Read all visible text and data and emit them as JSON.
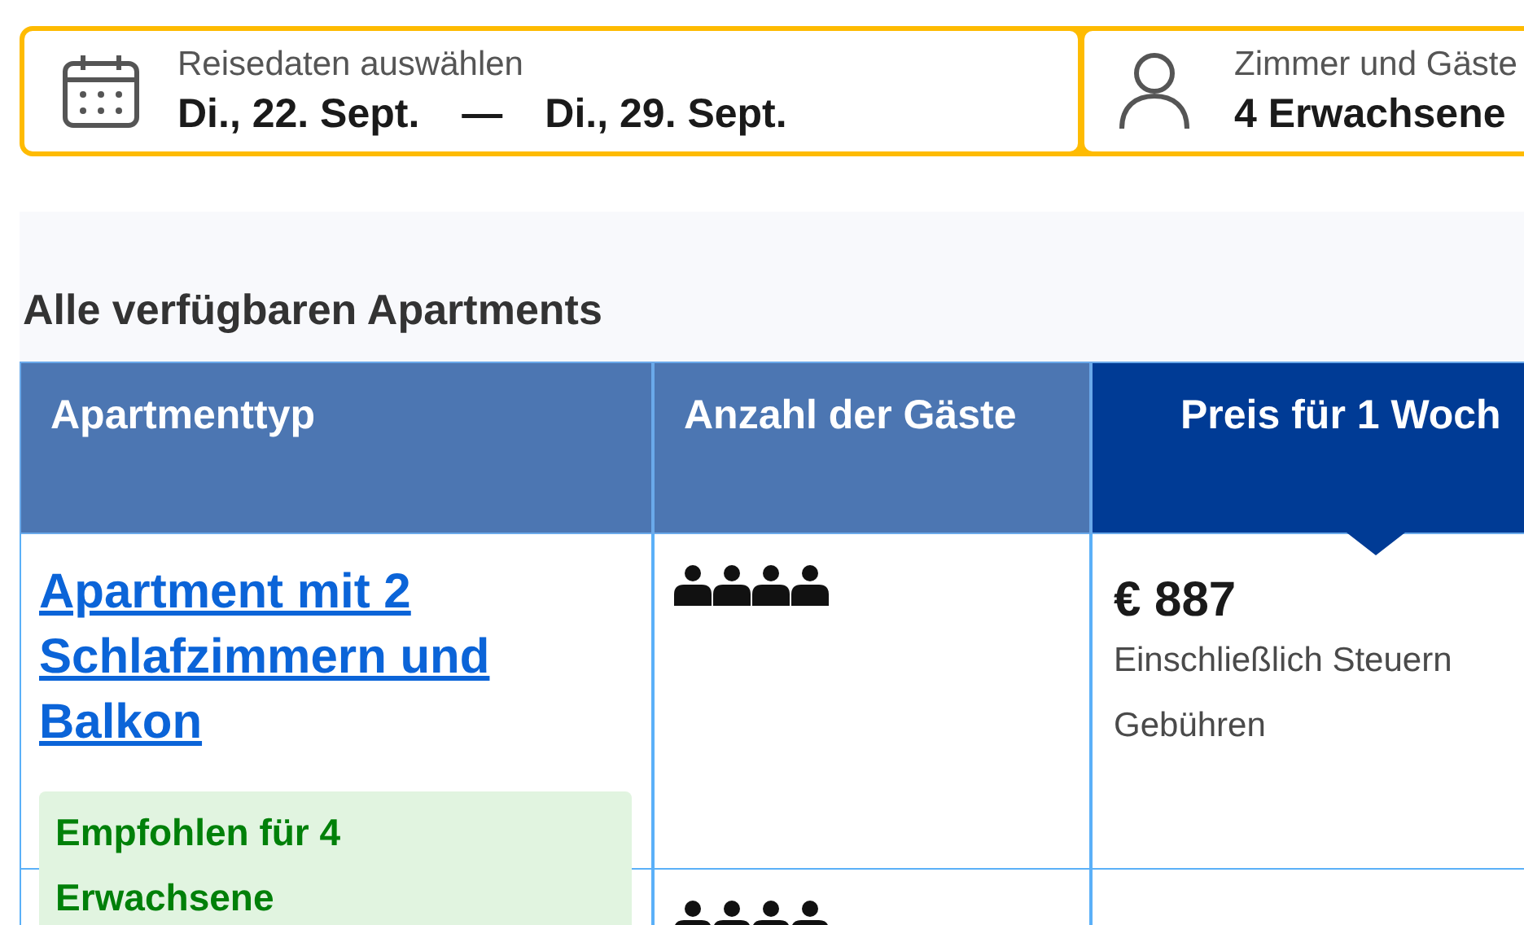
{
  "search_bar": {
    "dates": {
      "label": "Reisedaten auswählen",
      "start": "Di., 22. Sept.",
      "separator": "—",
      "end": "Di., 29. Sept."
    },
    "guests": {
      "label": "Zimmer und Gäste",
      "value": "4 Erwachsene"
    }
  },
  "section_title": "Alle verfügbaren Apartments",
  "table": {
    "columns": [
      {
        "label": "Apartmenttyp",
        "selected": false
      },
      {
        "label": "Anzahl der Gäste",
        "selected": false
      },
      {
        "label": "Preis für 1 Woch",
        "selected": true
      }
    ],
    "rows": [
      {
        "apartment": "Apartment mit 2 Schlafzimmern und Balkon",
        "badge": "Empfohlen für 4 Erwachsene",
        "guests": [
          {
            "kind": "adult"
          },
          {
            "kind": "adult"
          },
          {
            "kind": "adult"
          },
          {
            "kind": "adult"
          }
        ],
        "price": "€ 887",
        "price_note": "Einschließlich Steuern",
        "price_note_2": "Gebühren"
      },
      {
        "guests": [
          {
            "kind": "adult"
          },
          {
            "kind": "adult"
          },
          {
            "kind": "adult"
          },
          {
            "kind": "adult"
          }
        ]
      }
    ]
  }
}
